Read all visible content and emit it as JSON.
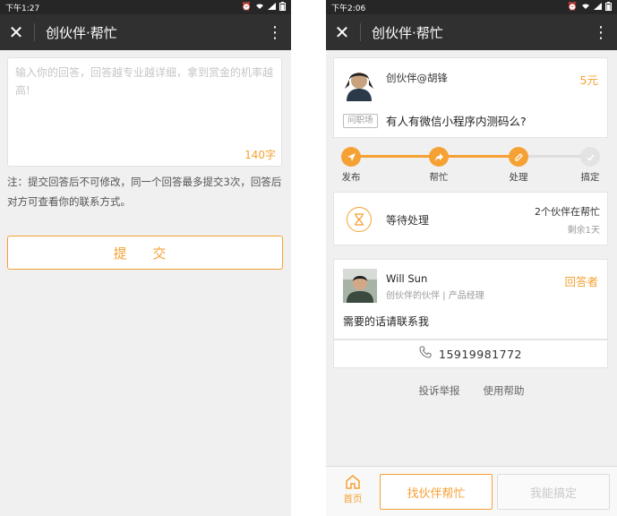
{
  "left": {
    "status_time": "下午1:27",
    "title": "创伙伴·帮忙",
    "answer_placeholder": "输入你的回答，回答越专业越详细，拿到赏金的机率越高!",
    "char_count": "140字",
    "note": "注：提交回答后不可修改，同一个回答最多提交3次，回答后对方可查看你的联系方式。",
    "submit_label": "提 交"
  },
  "right": {
    "status_time": "下午2:06",
    "title": "创伙伴·帮忙",
    "question": {
      "author": "创伙伴@胡锋",
      "reward": "5元",
      "tag": "问职场",
      "text": "有人有微信小程序内测码么?"
    },
    "progress": {
      "steps": [
        {
          "label": "发布",
          "icon": "send-icon",
          "done": true
        },
        {
          "label": "帮忙",
          "icon": "share-icon",
          "done": true
        },
        {
          "label": "处理",
          "icon": "pencil-icon",
          "done": true
        },
        {
          "label": "搞定",
          "icon": "check-icon",
          "done": false
        }
      ]
    },
    "wait": {
      "status": "等待处理",
      "helpers": "2个伙伴在帮忙",
      "remaining": "剩余1天"
    },
    "answer": {
      "name": "Will Sun",
      "subtitle": "创伙伴的伙伴 | 产品经理",
      "badge": "回答者",
      "text": "需要的话请联系我",
      "phone": "15919981772"
    },
    "links": {
      "report": "投诉举报",
      "help": "使用帮助"
    },
    "bottom": {
      "home_label": "首页",
      "find_help": "找伙伴帮忙",
      "can_solve": "我能搞定"
    }
  },
  "colors": {
    "accent": "#f5a133",
    "nav_bg": "#303030",
    "status_bg": "#262626",
    "page_bg": "#f0f0f0"
  }
}
